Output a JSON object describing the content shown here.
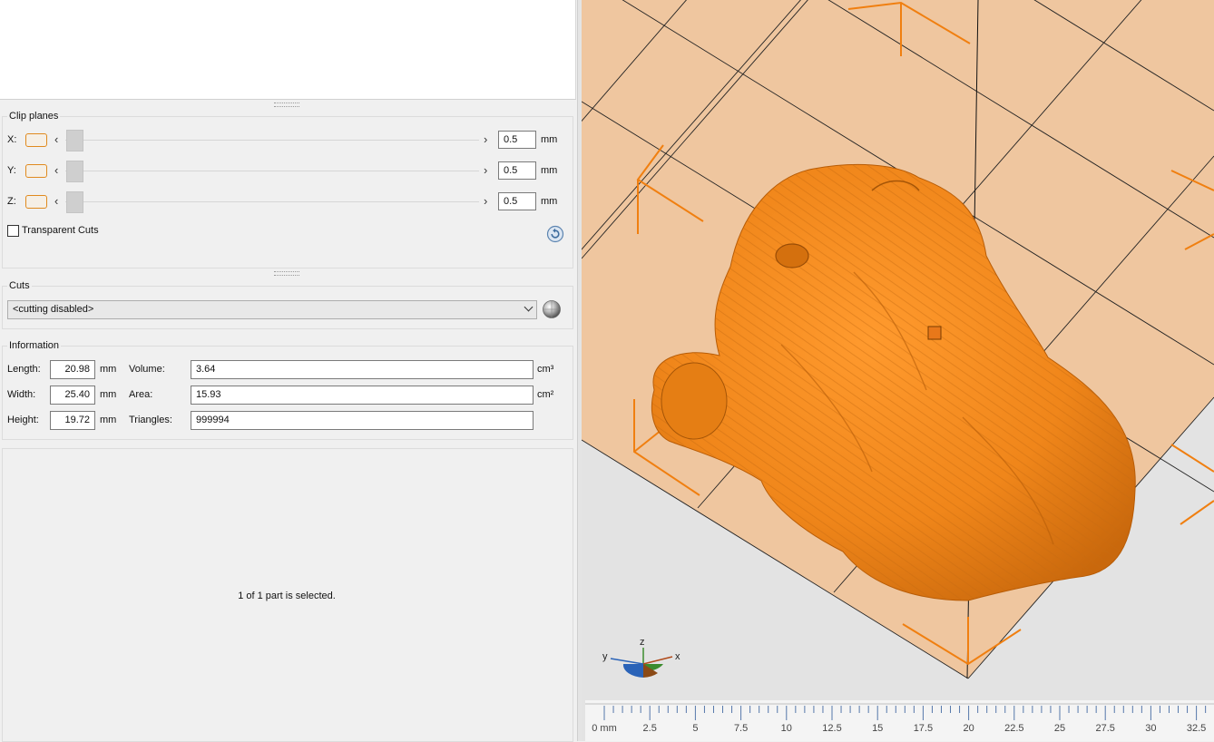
{
  "clip_planes": {
    "title": "Clip planes",
    "rows": [
      {
        "axis": "X:",
        "value": "0.5",
        "unit": "mm"
      },
      {
        "axis": "Y:",
        "value": "0.5",
        "unit": "mm"
      },
      {
        "axis": "Z:",
        "value": "0.5",
        "unit": "mm"
      }
    ],
    "arrow_left": "‹",
    "arrow_right": "›",
    "transparent_cuts_label": "Transparent Cuts",
    "transparent_cuts_checked": false
  },
  "cuts": {
    "title": "Cuts",
    "selected": "<cutting disabled>"
  },
  "information": {
    "title": "Information",
    "length_label": "Length:",
    "length": "20.98",
    "length_unit": "mm",
    "width_label": "Width:",
    "width": "25.40",
    "width_unit": "mm",
    "height_label": "Height:",
    "height": "19.72",
    "height_unit": "mm",
    "volume_label": "Volume:",
    "volume": "3.64",
    "volume_unit": "cm³",
    "area_label": "Area:",
    "area": "15.93",
    "area_unit": "cm²",
    "triangles_label": "Triangles:",
    "triangles": "999994"
  },
  "status": "1 of 1 part is selected.",
  "viewport": {
    "axis_gizmo": {
      "x": "x",
      "y": "y",
      "z": "z"
    },
    "ruler_ticks": [
      "0 mm",
      "2.5",
      "5",
      "7.5",
      "10",
      "12.5",
      "15",
      "17.5",
      "20",
      "22.5",
      "25",
      "27.5",
      "30",
      "32.5"
    ],
    "colors": {
      "model": "#f08a1c",
      "bed": "#efc69f",
      "grid": "#1a1a1a",
      "bounds": "#f07f10"
    }
  }
}
